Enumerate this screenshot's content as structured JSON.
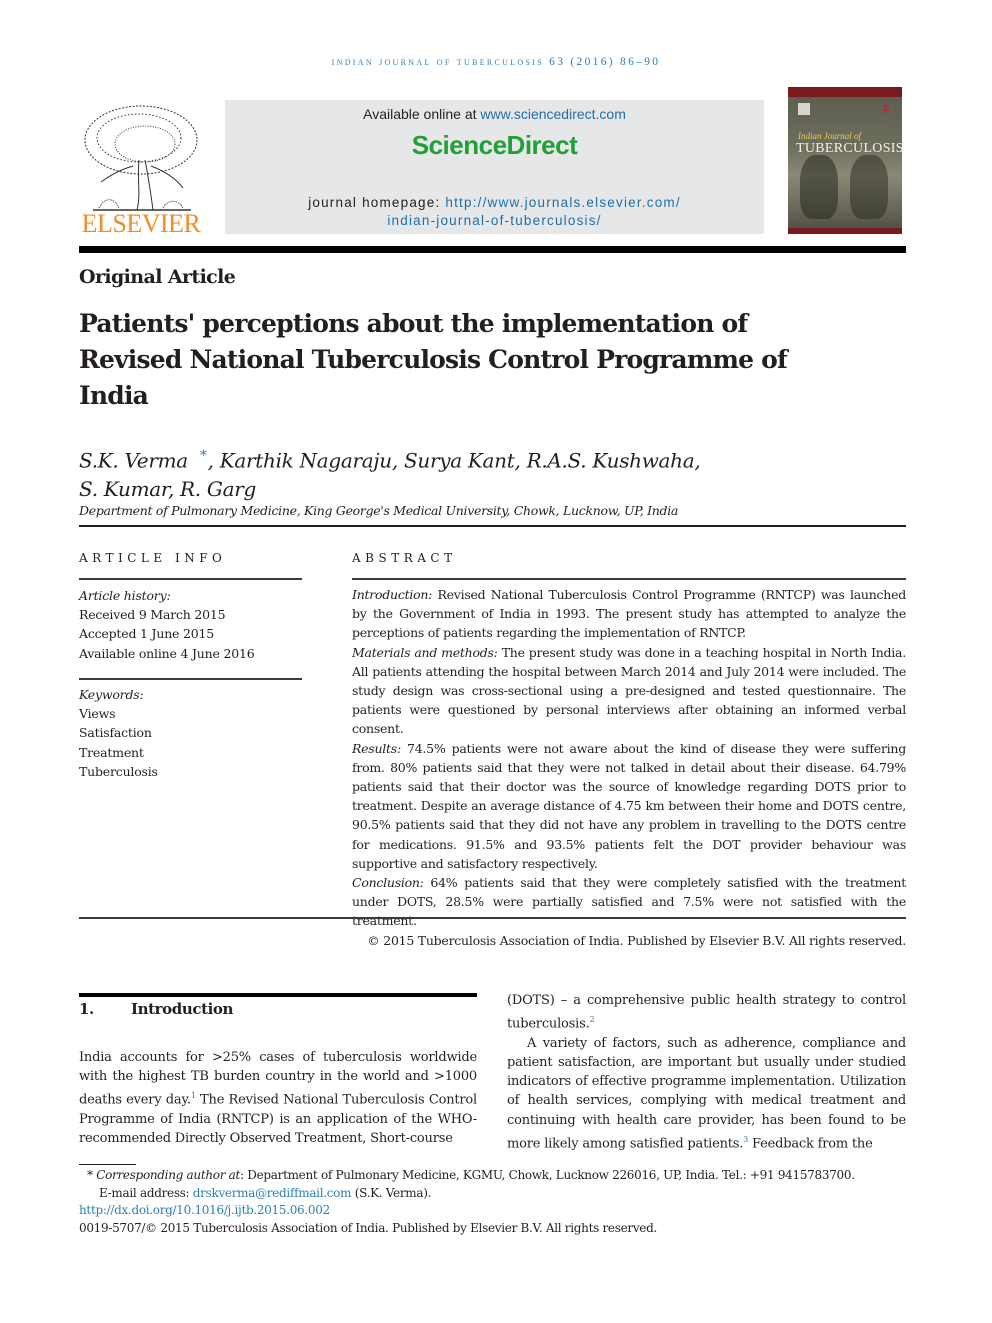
{
  "running_head": "Indian Journal of Tuberculosis 63 (2016) 86–90",
  "header": {
    "publisher_logo_text": "ELSEVIER",
    "available_online_prefix": "Available online at ",
    "available_online_link": "www.sciencedirect.com",
    "sciencedirect_logo": "ScienceDirect",
    "homepage_prefix": "journal homepage: ",
    "homepage_link_line1": "http://www.journals.elsevier.com/",
    "homepage_link_line2": "indian-journal-of-tuberculosis/",
    "cover": {
      "subtitle": "Indian Journal of",
      "title": "TUBERCULOSIS"
    }
  },
  "colors": {
    "link_blue": "#2f7fae",
    "sciencedirect_green": "#21a036",
    "elsevier_orange": "#f28c28",
    "cover_red": "#7b1a1c"
  },
  "article": {
    "type": "Original Article",
    "title": "Patients' perceptions about the implementation of Revised National Tuberculosis Control Programme of India",
    "authors_line1_first": "S.K. Verma",
    "author_marker": "*",
    "authors_line1_rest": ", Karthik Nagaraju, Surya Kant, R.A.S. Kushwaha,",
    "authors_line2": "S. Kumar, R. Garg",
    "affiliation": "Department of Pulmonary Medicine, King George's Medical University, Chowk, Lucknow, UP, India"
  },
  "article_info": {
    "heading": "ARTICLE INFO",
    "history_label": "Article history:",
    "history": [
      "Received 9 March 2015",
      "Accepted 1 June 2015",
      "Available online 4 June 2016"
    ],
    "keywords_label": "Keywords:",
    "keywords": [
      "Views",
      "Satisfaction",
      "Treatment",
      "Tuberculosis"
    ]
  },
  "abstract": {
    "heading": "ABSTRACT",
    "sections": [
      {
        "label": "Introduction:",
        "text": "Revised National Tuberculosis Control Programme (RNTCP) was launched by the Government of India in 1993. The present study has attempted to analyze the perceptions of patients regarding the implementation of RNTCP."
      },
      {
        "label": "Materials and methods:",
        "text": "The present study was done in a teaching hospital in North India. All patients attending the hospital between March 2014 and July 2014 were included. The study design was cross-sectional using a pre-designed and tested questionnaire. The patients were questioned by personal interviews after obtaining an informed verbal consent."
      },
      {
        "label": "Results:",
        "text": "74.5% patients were not aware about the kind of disease they were suffering from. 80% patients said that they were not talked in detail about their disease. 64.79% patients said that their doctor was the source of knowledge regarding DOTS prior to treatment. Despite an average distance of 4.75 km between their home and DOTS centre, 90.5% patients said that they did not have any problem in travelling to the DOTS centre for medications. 91.5% and 93.5% patients felt the DOT provider behaviour was supportive and satisfactory respectively."
      },
      {
        "label": "Conclusion:",
        "text": "64% patients said that they were completely satisfied with the treatment under DOTS, 28.5% were partially satisfied and 7.5% were not satisfied with the treatment."
      }
    ],
    "copyright": "© 2015 Tuberculosis Association of India. Published by Elsevier B.V. All rights reserved."
  },
  "introduction": {
    "number": "1.",
    "heading": "Introduction",
    "left_p1_a": "India accounts for >25% cases of tuberculosis worldwide with the highest TB burden country in the world and >1000 deaths every day.",
    "ref1": "1",
    "left_p1_b": " The Revised National Tuberculosis Control Programme of India (RNTCP) is an application of the WHO-recommended Directly Observed Treatment, Short-course",
    "right_p1_a": "(DOTS) – a comprehensive public health strategy to control tuberculosis.",
    "ref2": "2",
    "right_p2_a": "A variety of factors, such as adherence, compliance and patient satisfaction, are important but usually under studied indicators of effective programme implementation. Utilization of health services, complying with medical treatment and continuing with health care provider, has been found to be more likely among satisfied patients.",
    "ref3": "3",
    "right_p2_b": " Feedback from the"
  },
  "footnotes": {
    "marker": "*",
    "corresponding_label": "Corresponding author at",
    "corresponding_text": ": Department of Pulmonary Medicine, KGMU, Chowk, Lucknow 226016, UP, India. Tel.: +91 9415783700.",
    "email_label": "E-mail address: ",
    "email": "drskverma@rediffmail.com",
    "email_suffix": " (S.K. Verma).",
    "doi": "http://dx.doi.org/10.1016/j.ijtb.2015.06.002",
    "issn_line": "0019-5707/© 2015 Tuberculosis Association of India. Published by Elsevier B.V. All rights reserved."
  }
}
